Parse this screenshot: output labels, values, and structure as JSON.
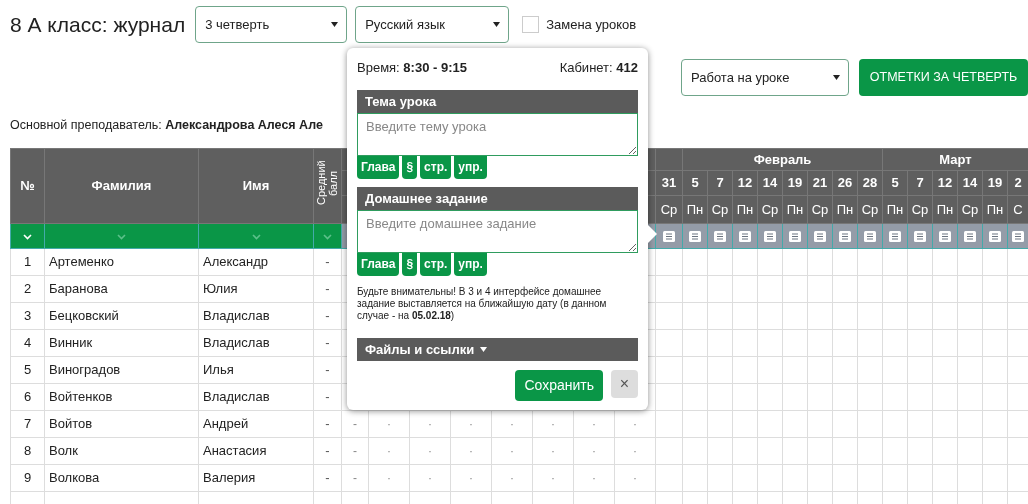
{
  "title": "8 А класс: журнал",
  "quarter_select": {
    "value": "3 четверть"
  },
  "subject_select": {
    "value": "Русский язык"
  },
  "substitution": {
    "label": "Замена уроков",
    "checked": false
  },
  "mode_select": {
    "value": "Работа на уроке"
  },
  "quarter_marks_button": "ОТМЕТКИ ЗА ЧЕТВЕРТЬ",
  "teacher": "Основной преподаватель: **Александрова Алеся Але**",
  "journal": {
    "columns": [
      {
        "label": "№",
        "filter_active": true
      },
      {
        "label": "Фамилия",
        "filter_active": false
      },
      {
        "label": "Имя",
        "filter_active": false
      },
      {
        "label": "Средний балл",
        "filter_active": false
      }
    ],
    "months": [
      {
        "days": [
          {
            "date": "31",
            "weekday": "Ср"
          }
        ]
      },
      {
        "label": "Февраль",
        "days": [
          {
            "date": "5",
            "weekday": "Пн"
          },
          {
            "date": "7",
            "weekday": "Ср"
          },
          {
            "date": "12",
            "weekday": "Пн"
          },
          {
            "date": "14",
            "weekday": "Ср"
          },
          {
            "date": "19",
            "weekday": "Пн"
          },
          {
            "date": "21",
            "weekday": "Ср"
          },
          {
            "date": "26",
            "weekday": "Пн"
          },
          {
            "date": "28",
            "weekday": "Ср"
          }
        ]
      },
      {
        "label": "Март",
        "days": [
          {
            "date": "5",
            "weekday": "Пн"
          },
          {
            "date": "7",
            "weekday": "Ср"
          },
          {
            "date": "12",
            "weekday": "Пн"
          },
          {
            "date": "14",
            "weekday": "Ср"
          },
          {
            "date": "19",
            "weekday": "Пн"
          },
          {
            "date": "2",
            "weekday": "С"
          }
        ]
      }
    ],
    "rows": [
      {
        "num": "1",
        "surname": "Артеменко",
        "name": "Александр",
        "average": "-"
      },
      {
        "num": "2",
        "surname": "Баранова",
        "name": "Юлия",
        "average": "-"
      },
      {
        "num": "3",
        "surname": "Бецковский",
        "name": "Владислав",
        "average": "-"
      },
      {
        "num": "4",
        "surname": "Винник",
        "name": "Владислав",
        "average": "-"
      },
      {
        "num": "5",
        "surname": "Виноградов",
        "name": "Илья",
        "average": "-"
      },
      {
        "num": "6",
        "surname": "Войтенков",
        "name": "Владислав",
        "average": "-"
      },
      {
        "num": "7",
        "surname": "Войтов",
        "name": "Андрей",
        "average": "-",
        "marks": [
          "-",
          "·",
          "·",
          "·",
          "·",
          "·",
          "·",
          "·"
        ]
      },
      {
        "num": "8",
        "surname": "Волк",
        "name": "Анастасия",
        "average": "-",
        "marks": [
          "-",
          "·",
          "·",
          "·",
          "·",
          "·",
          "·",
          "·"
        ]
      },
      {
        "num": "9",
        "surname": "Волкова",
        "name": "Валерия",
        "average": "-",
        "marks": [
          "-",
          "·",
          "·",
          "·",
          "·",
          "·",
          "·",
          "·"
        ]
      }
    ]
  },
  "lesson_popover": {
    "time": "Время: **8:30 - 9:15**",
    "room": "Кабинет: **412**",
    "sections": [
      {
        "title": "Тема урока",
        "placeholder": "Введите тему урока",
        "tools": [
          "Глава",
          "§",
          "стр.",
          "упр."
        ]
      },
      {
        "title": "Домашнее задание",
        "placeholder": "Введите домашнее задание",
        "tools": [
          "Глава",
          "§",
          "стр.",
          "упр."
        ]
      }
    ],
    "note": "Будьте внимательны! В 3 и 4 интерфейсе домашнее задание выставляется на ближайшую дату (в данном случае - на **05.02.18**)",
    "files": "Файлы и ссылки",
    "save": "Сохранить",
    "close": "×"
  }
}
